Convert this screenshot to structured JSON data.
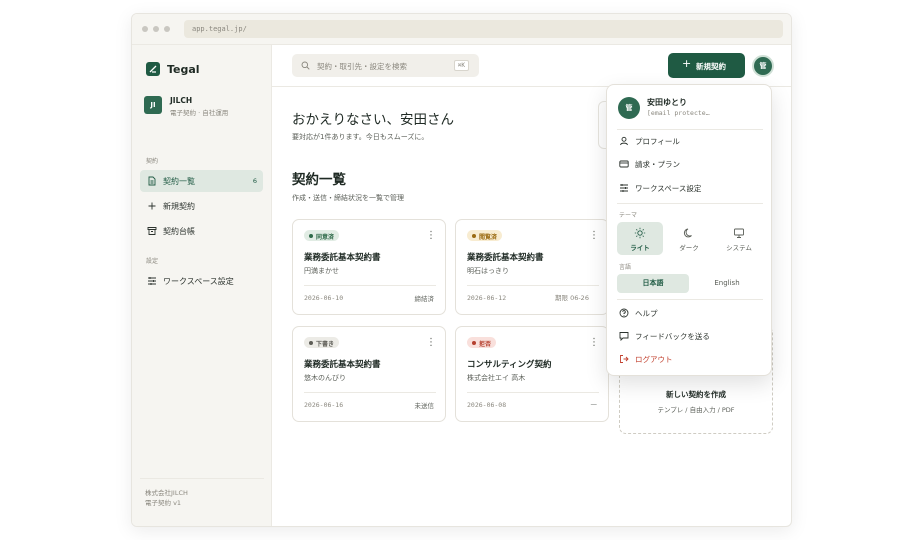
{
  "browser": {
    "url": "app.tegal.jp/"
  },
  "brand": {
    "name": "Tegal"
  },
  "org": {
    "initials": "JI",
    "name": "JILCH",
    "subtitle": "電子契約 · 自社運用"
  },
  "sidebar": {
    "section_contracts": "契約",
    "items": [
      {
        "label": "契約一覧",
        "count": "6",
        "icon": "document-icon"
      },
      {
        "label": "新規契約",
        "icon": "plus-icon"
      },
      {
        "label": "契約台帳",
        "icon": "archive-icon"
      }
    ],
    "section_settings": "設定",
    "settings_items": [
      {
        "label": "ワークスペース設定",
        "icon": "sliders-icon"
      }
    ],
    "footer_company": "株式会社JILCH",
    "footer_version": "電子契約 v1"
  },
  "topbar": {
    "search_placeholder": "契約・取引先・設定を検索",
    "search_shortcut": "⌘K",
    "new_button": "新規契約",
    "user_initial": "管"
  },
  "main": {
    "greeting": "おかえりなさい、安田さん",
    "greeting_sub": "要対応が1件あります。今日もスムーズに。",
    "list_title": "契約一覧",
    "list_sub": "作成・送信・締結状況を一覧で管理",
    "cards": [
      {
        "badge": "同意済",
        "title": "業務委託基本契約書",
        "party": "円満まかせ",
        "date": "2026-06-10",
        "status": "締結済",
        "due": ""
      },
      {
        "badge": "閲覧済",
        "title": "業務委託基本契約書",
        "party": "明石はっきり",
        "date": "2026-06-12",
        "status": "",
        "due": "期限 06-26"
      },
      {
        "badge": "下書き",
        "title": "業務委託基本契約書",
        "party": "悠木のんびり",
        "date": "2026-06-16",
        "status": "未送信",
        "due": ""
      },
      {
        "badge": "拒否",
        "title": "コンサルティング契約",
        "party": "株式会社エイ 高木",
        "date": "2026-06-08",
        "status": "—",
        "due": ""
      }
    ],
    "new_card_title": "新しい契約を作成",
    "new_card_sub": "テンプレ / 自由入力 / PDF"
  },
  "user_menu": {
    "initial": "管",
    "name": "安田ゆとり",
    "email": "[email protecte…",
    "items": [
      {
        "label": "プロフィール",
        "icon": "user-icon"
      },
      {
        "label": "請求・プラン",
        "icon": "card-icon"
      },
      {
        "label": "ワークスペース設定",
        "icon": "sliders-icon"
      }
    ],
    "theme_label": "テーマ",
    "themes": [
      {
        "label": "ライト",
        "icon": "sun-icon",
        "selected": true
      },
      {
        "label": "ダーク",
        "icon": "moon-icon",
        "selected": false
      },
      {
        "label": "システム",
        "icon": "monitor-icon",
        "selected": false
      }
    ],
    "language_label": "言語",
    "languages": [
      {
        "label": "日本語",
        "selected": true
      },
      {
        "label": "English",
        "selected": false
      }
    ],
    "help": "ヘルプ",
    "feedback": "フィードバックを送る",
    "logout": "ログアウト"
  },
  "colors": {
    "brand": "#1f5a43",
    "accent_bg": "#dfe8e1",
    "danger": "#c2412f"
  }
}
